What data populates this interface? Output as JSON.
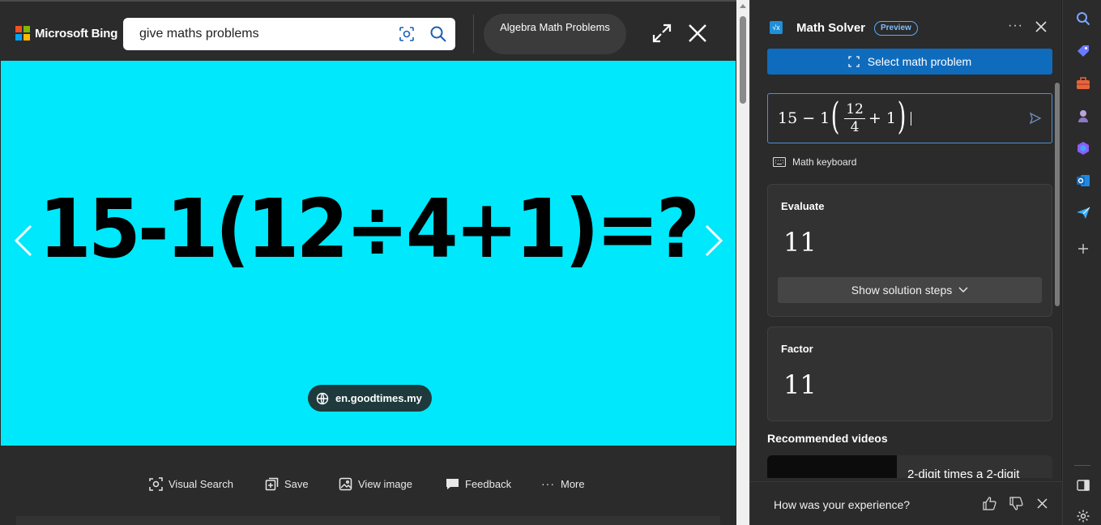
{
  "header": {
    "brand": "Microsoft Bing",
    "search_value": "give maths problems",
    "related_pill": "Algebra Math Problems"
  },
  "image": {
    "equation_text": "15-1(12÷4+1)=?",
    "background_color": "#00e8fb",
    "source": "en.goodtimes.my"
  },
  "actions": {
    "visual_search": "Visual Search",
    "save": "Save",
    "view_image": "View image",
    "feedback": "Feedback",
    "more": "More"
  },
  "math_solver": {
    "title": "Math Solver",
    "badge": "Preview",
    "select_button": "Select math problem",
    "input": {
      "lead": "15 − 1",
      "numerator": "12",
      "denominator": "4",
      "tail": "+ 1"
    },
    "keyboard_link": "Math keyboard",
    "evaluate": {
      "label": "Evaluate",
      "value": "11",
      "steps_button": "Show solution steps"
    },
    "factor": {
      "label": "Factor",
      "value": "11"
    },
    "recommended": {
      "title": "Recommended videos",
      "video_title": "2-digit times a 2-digit"
    },
    "feedback_question": "How was your experience?"
  },
  "colors": {
    "accent_blue": "#0f6cbd",
    "pane_bg": "#2b2b2b",
    "image_bg": "#00e8fb"
  }
}
